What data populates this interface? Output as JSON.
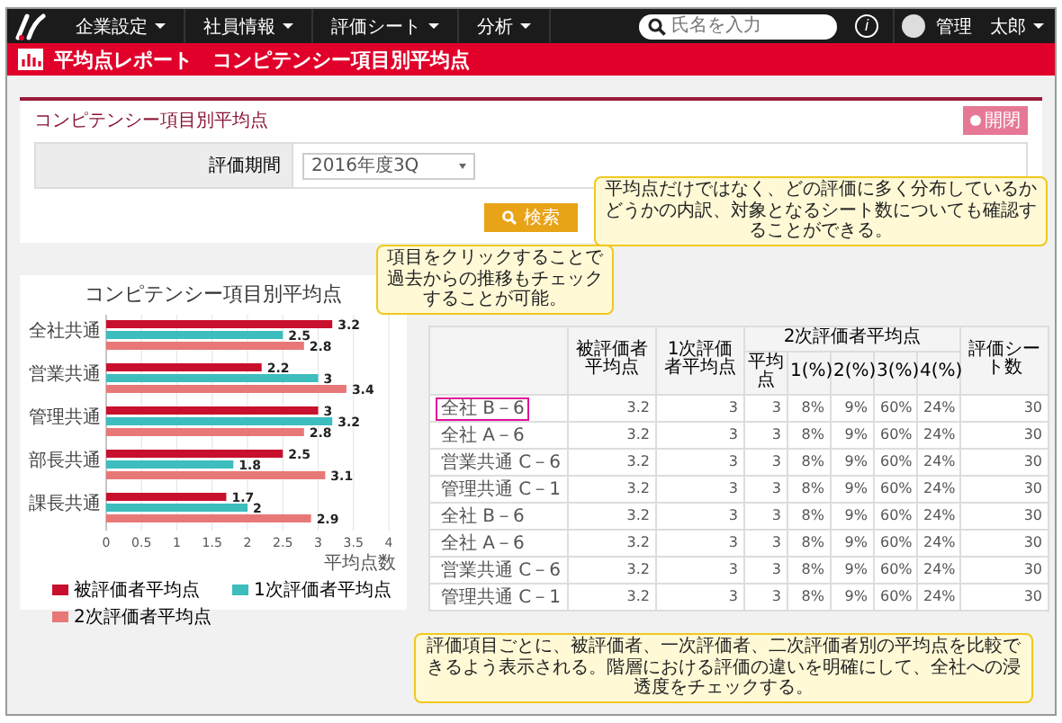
{
  "nav": {
    "items": [
      {
        "label": "企業設定"
      },
      {
        "label": "社員情報"
      },
      {
        "label": "評価シート"
      },
      {
        "label": "分析"
      }
    ],
    "search": {
      "placeholder": "氏名を入力"
    },
    "info": "i",
    "user": "管理　太郎"
  },
  "page_title": "平均点レポート　コンピテンシー項目別平均点",
  "panel": {
    "title": "コンピテンシー項目別平均点",
    "toggle_button": "開閉",
    "filter": {
      "label": "評価期間",
      "value": "2016年度3Q"
    },
    "search_button": "検索"
  },
  "chart_data": {
    "type": "bar",
    "orientation": "horizontal",
    "title": "コンピテンシー項目別平均点",
    "xlabel": "平均点数",
    "categories": [
      "全社共通",
      "営業共通",
      "管理共通",
      "部長共通",
      "課長共通"
    ],
    "series": [
      {
        "name": "被評価者平均点",
        "color": "#c8102e",
        "values": [
          3.2,
          2.2,
          3,
          2.5,
          1.7
        ]
      },
      {
        "name": "1次評価者平均点",
        "color": "#3dbdbd",
        "values": [
          2.5,
          3,
          3.2,
          1.8,
          2
        ]
      },
      {
        "name": "2次評価者平均点",
        "color": "#e87878",
        "values": [
          2.8,
          3.4,
          2.8,
          3.1,
          2.9
        ]
      }
    ],
    "xlim": [
      0,
      4
    ],
    "xticks": [
      0,
      0.5,
      1,
      1.5,
      2,
      2.5,
      3,
      3.5,
      4
    ],
    "data_labels": true,
    "grid": true,
    "legend": true
  },
  "table": {
    "columns": [
      {
        "label": "被評価者平均点"
      },
      {
        "label": "1次評価者平均点"
      },
      {
        "label": "2次評価者平均点",
        "children": [
          {
            "label": "平均点"
          },
          {
            "label": "1(%)"
          },
          {
            "label": "2(%)"
          },
          {
            "label": "3(%)"
          },
          {
            "label": "4(%)"
          }
        ]
      },
      {
        "label": "評価シート数"
      }
    ],
    "rows": [
      {
        "label": "全社 B－6",
        "selected": true,
        "values": [
          "3.2",
          "3",
          "3",
          "8%",
          "9%",
          "60%",
          "24%",
          "30"
        ]
      },
      {
        "label": "全社 A－6",
        "selected": false,
        "values": [
          "3.2",
          "3",
          "3",
          "8%",
          "9%",
          "60%",
          "24%",
          "30"
        ]
      },
      {
        "label": "営業共通 C－6",
        "selected": false,
        "values": [
          "3.2",
          "3",
          "3",
          "8%",
          "9%",
          "60%",
          "24%",
          "30"
        ]
      },
      {
        "label": "管理共通 C－1",
        "selected": false,
        "values": [
          "3.2",
          "3",
          "3",
          "8%",
          "9%",
          "60%",
          "24%",
          "30"
        ]
      },
      {
        "label": "全社 B－6",
        "selected": false,
        "values": [
          "3.2",
          "3",
          "3",
          "8%",
          "9%",
          "60%",
          "24%",
          "30"
        ]
      },
      {
        "label": "全社 A－6",
        "selected": false,
        "values": [
          "3.2",
          "3",
          "3",
          "8%",
          "9%",
          "60%",
          "24%",
          "30"
        ]
      },
      {
        "label": "営業共通 C－6",
        "selected": false,
        "values": [
          "3.2",
          "3",
          "3",
          "8%",
          "9%",
          "60%",
          "24%",
          "30"
        ]
      },
      {
        "label": "管理共通 C－1",
        "selected": false,
        "values": [
          "3.2",
          "3",
          "3",
          "8%",
          "9%",
          "60%",
          "24%",
          "30"
        ]
      }
    ]
  },
  "callouts": [
    {
      "text": "項目をクリックすることで過去からの推移もチェックすることが可能。"
    },
    {
      "text": "平均点だけではなく、どの評価に多く分布しているかどうかの内訳、対象となるシート数についても確認することができる。"
    },
    {
      "text": "評価項目ごとに、被評価者、一次評価者、二次評価者別の平均点を比較できるよう表示される。階層における評価の違いを明確にして、全社への浸透度をチェックする。"
    }
  ]
}
